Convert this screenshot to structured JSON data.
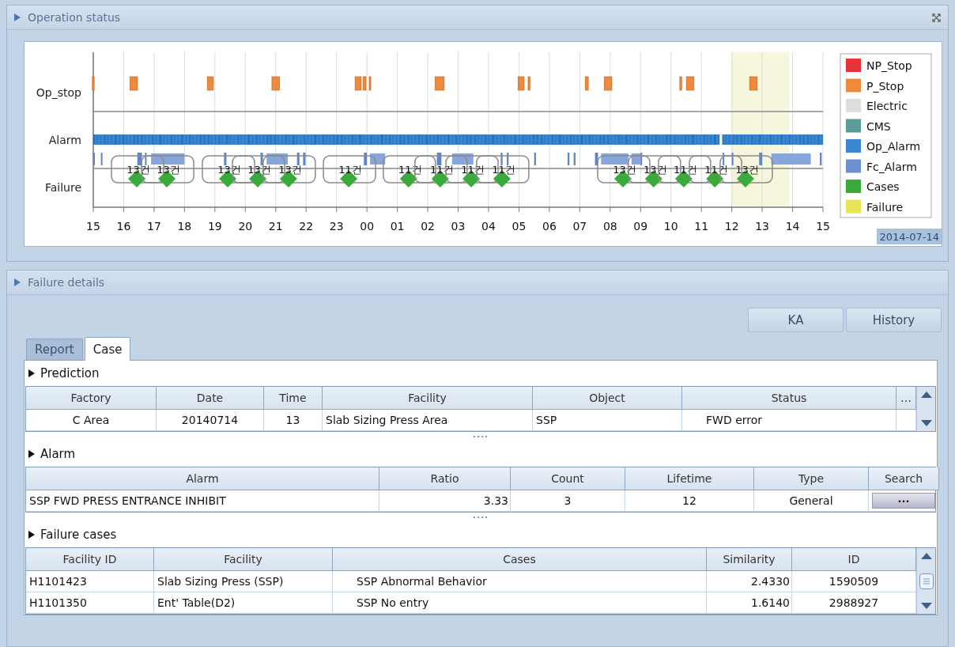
{
  "operation_status": {
    "title": "Operation status",
    "timeline": {
      "row_labels": [
        "Op_stop",
        "Alarm",
        "Failure"
      ],
      "hour_labels": [
        "15",
        "16",
        "17",
        "18",
        "19",
        "20",
        "21",
        "22",
        "23",
        "00",
        "01",
        "02",
        "03",
        "04",
        "05",
        "06",
        "07",
        "08",
        "09",
        "10",
        "11",
        "12",
        "13",
        "14",
        "15"
      ],
      "case_labels": [
        "13건",
        "13건",
        "13건",
        "13건",
        "13건",
        "11건",
        "11건",
        "11건",
        "11건",
        "11건",
        "13건",
        "13건",
        "11건",
        "11건",
        "13건"
      ]
    },
    "legend": [
      {
        "label": "NP_Stop",
        "color": "#e8323a"
      },
      {
        "label": "P_Stop",
        "color": "#ee8a3c"
      },
      {
        "label": "Electric",
        "color": "#dedede"
      },
      {
        "label": "CMS",
        "color": "#5d9a98"
      },
      {
        "label": "Op_Alarm",
        "color": "#3a86d0"
      },
      {
        "label": "Fc_Alarm",
        "color": "#6a90cf"
      },
      {
        "label": "Cases",
        "color": "#3aab3a"
      },
      {
        "label": "Failure",
        "color": "#e8e455"
      }
    ],
    "date": "2014-07-14"
  },
  "failure_details": {
    "title": "Failure details",
    "buttons": [
      "KA",
      "History"
    ],
    "tabs": [
      {
        "label": "Report",
        "selected": false
      },
      {
        "label": "Case",
        "selected": true
      }
    ],
    "prediction": {
      "title": "Prediction",
      "columns": [
        "Factory",
        "Date",
        "Time",
        "Facility",
        "Object",
        "Status",
        "…"
      ],
      "rows": [
        [
          "C Area",
          "20140714",
          "13",
          "Slab Sizing Press Area",
          "SSP",
          "FWD error"
        ]
      ]
    },
    "alarm": {
      "title": "Alarm",
      "columns": [
        "Alarm",
        "Ratio",
        "Count",
        "Lifetime",
        "Type",
        "Search"
      ],
      "rows": [
        {
          "cells": [
            "SSP FWD PRESS ENTRANCE INHIBIT",
            "3.33",
            "3",
            "12",
            "General"
          ],
          "search_button": "···"
        }
      ]
    },
    "failure_cases": {
      "title": "Failure cases",
      "columns": [
        "Facility ID",
        "Facility",
        "Cases",
        "Similarity",
        "ID"
      ],
      "rows": [
        [
          "H1101423",
          "Slab Sizing Press (SSP)",
          "SSP Abnormal Behavior",
          "2.4330",
          "1590509"
        ],
        [
          "H1101350",
          "Ent' Table(D2)",
          "SSP No entry",
          "1.6140",
          "2988927"
        ]
      ]
    }
  }
}
